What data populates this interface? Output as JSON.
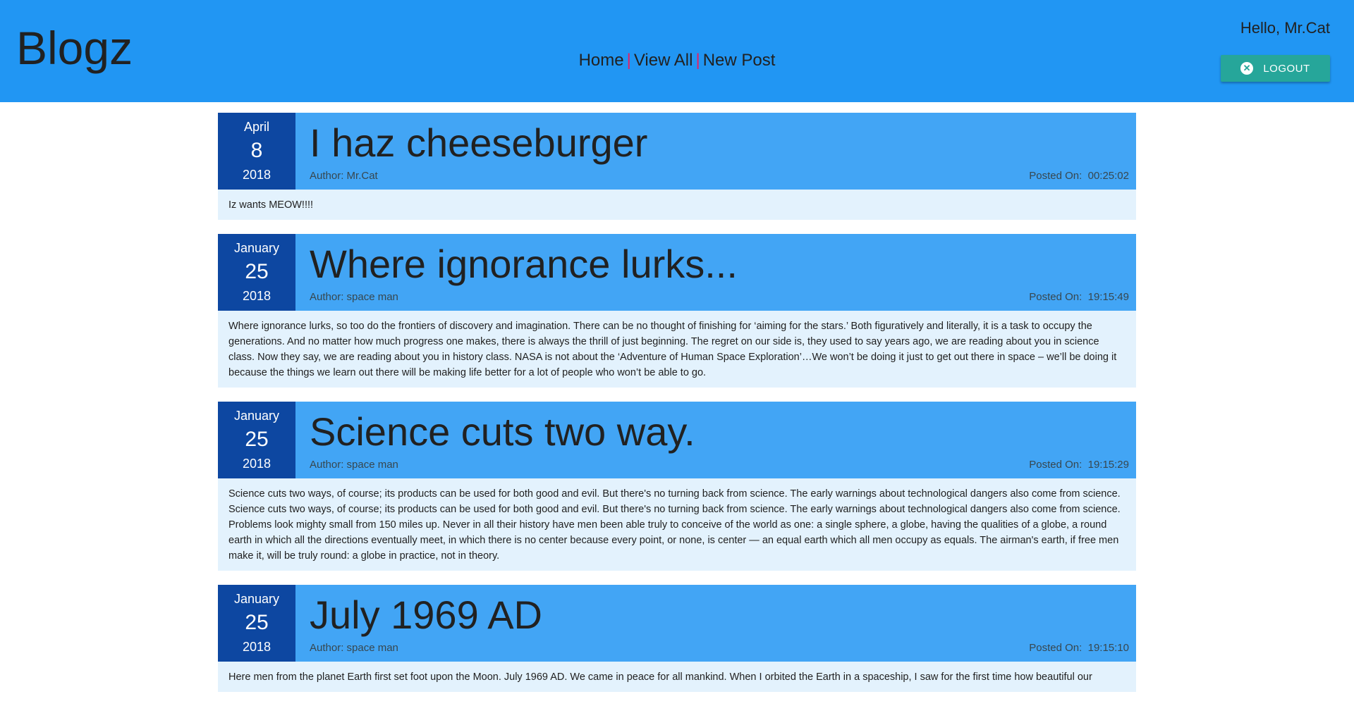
{
  "header": {
    "brand": "Blogz",
    "nav": {
      "home": "Home",
      "view_all": "View All",
      "new_post": "New Post",
      "separator": "|"
    },
    "greeting": "Hello, Mr.Cat",
    "logout_label": "LOGOUT"
  },
  "colors": {
    "topbar": "#2196f3",
    "post_header": "#42a5f5",
    "date_box": "#0d47a1",
    "post_body": "#e3f2fd",
    "logout_button": "#26a69a",
    "nav_separator": "#e91e63"
  },
  "posts": [
    {
      "month": "April",
      "day": "8",
      "year": "2018",
      "title": "I haz cheeseburger",
      "author": "Author: Mr.Cat",
      "posted": "Posted On:  00:25:02",
      "body": "Iz wants MEOW!!!!"
    },
    {
      "month": "January",
      "day": "25",
      "year": "2018",
      "title": "Where ignorance lurks...",
      "author": "Author: space man",
      "posted": "Posted On:  19:15:49",
      "body": "Where ignorance lurks, so too do the frontiers of discovery and imagination. There can be no thought of finishing for ‘aiming for the stars.’ Both figuratively and literally, it is a task to occupy the generations. And no matter how much progress one makes, there is always the thrill of just beginning. The regret on our side is, they used to say years ago, we are reading about you in science class. Now they say, we are reading about you in history class. NASA is not about the ‘Adventure of Human Space Exploration’…We won’t be doing it just to get out there in space – we’ll be doing it because the things we learn out there will be making life better for a lot of people who won’t be able to go."
    },
    {
      "month": "January",
      "day": "25",
      "year": "2018",
      "title": "Science cuts two way.",
      "author": "Author: space man",
      "posted": "Posted On:  19:15:29",
      "body": "Science cuts two ways, of course; its products can be used for both good and evil. But there's no turning back from science. The early warnings about technological dangers also come from science. Science cuts two ways, of course; its products can be used for both good and evil. But there's no turning back from science. The early warnings about technological dangers also come from science. Problems look mighty small from 150 miles up. Never in all their history have men been able truly to conceive of the world as one: a single sphere, a globe, having the qualities of a globe, a round earth in which all the directions eventually meet, in which there is no center because every point, or none, is center — an equal earth which all men occupy as equals. The airman's earth, if free men make it, will be truly round: a globe in practice, not in theory."
    },
    {
      "month": "January",
      "day": "25",
      "year": "2018",
      "title": "July 1969 AD",
      "author": "Author: space man",
      "posted": "Posted On:  19:15:10",
      "body": "Here men from the planet Earth first set foot upon the Moon. July 1969 AD. We came in peace for all mankind. When I orbited the Earth in a spaceship, I saw for the first time how beautiful our"
    }
  ]
}
